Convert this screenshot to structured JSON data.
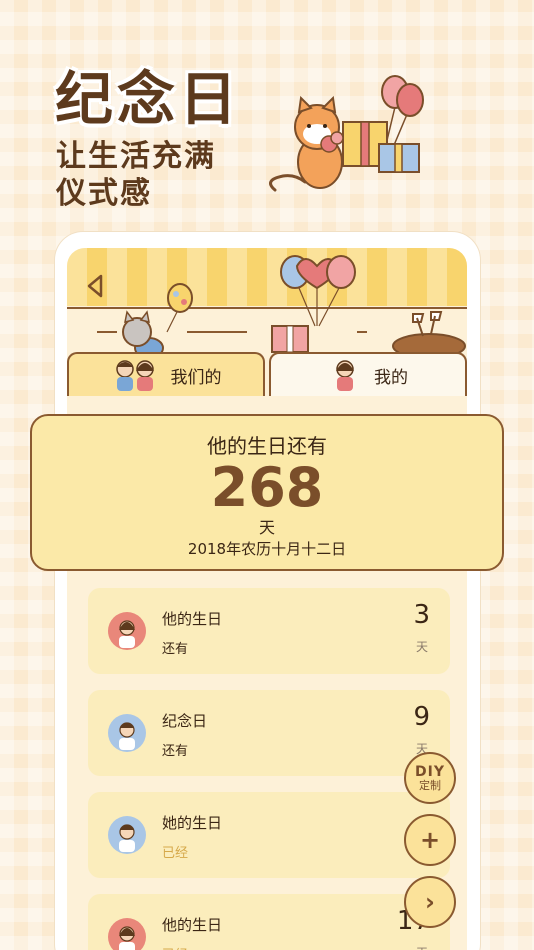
{
  "promo": {
    "headline": "纪念日",
    "subtitle_line1": "让生活充满",
    "subtitle_line2": "仪式感"
  },
  "tabs": [
    {
      "label": "我们的",
      "active": true
    },
    {
      "label": "我的",
      "active": false
    }
  ],
  "highlight": {
    "title": "他的生日还有",
    "count": "268",
    "unit": "天",
    "date": "2018年农历十月十二日"
  },
  "items": [
    {
      "name": "他的生日",
      "status": "还有",
      "days": "3",
      "unit": "天",
      "avatar": "couple-avatar-icon",
      "avatar_bg": "#e9877a"
    },
    {
      "name": "纪念日",
      "status": "还有",
      "days": "9",
      "unit": "天",
      "avatar": "boy-avatar-icon",
      "avatar_bg": "#a9c6e6"
    },
    {
      "name": "她的生日",
      "status": "已经",
      "days": "",
      "unit": "",
      "avatar": "boy-avatar-icon",
      "avatar_bg": "#a9c6e6"
    },
    {
      "name": "他的生日",
      "status": "已经",
      "days": "17",
      "unit": "天",
      "avatar": "couple-avatar-icon",
      "avatar_bg": "#e9877a"
    }
  ],
  "fabs": {
    "diy_top": "DIY",
    "diy_bottom": "定制",
    "add": "+",
    "next": "›"
  },
  "colors": {
    "background": "#fbead0",
    "accent": "#fbe29a",
    "brown": "#7a4e2a",
    "card": "#fbedbc"
  }
}
